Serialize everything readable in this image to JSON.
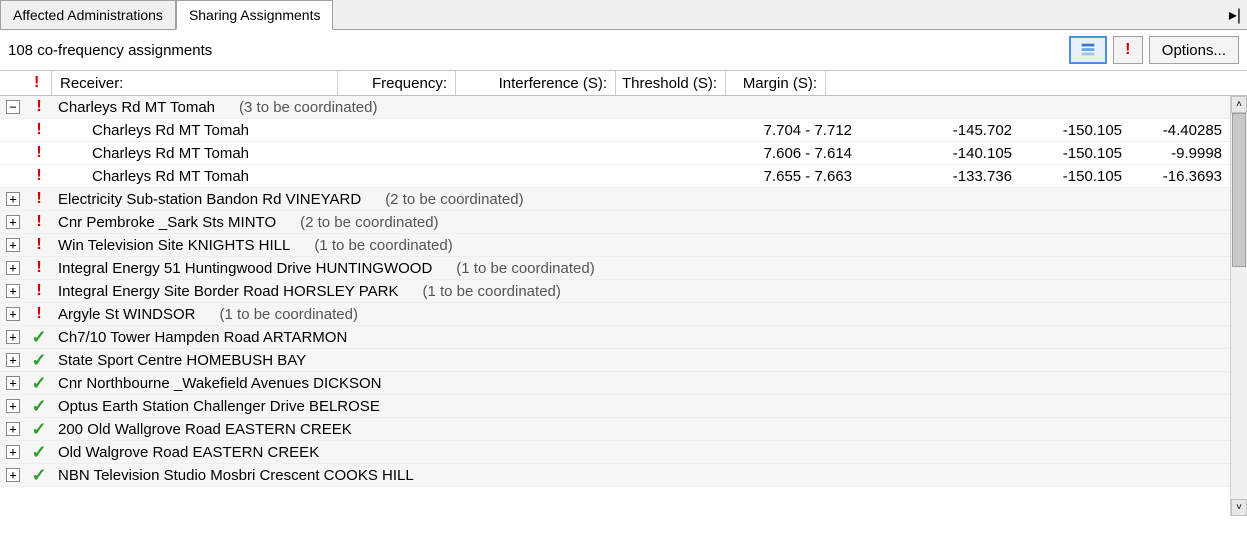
{
  "tabs": [
    {
      "label": "Affected Administrations",
      "active": false
    },
    {
      "label": "Sharing Assignments",
      "active": true
    }
  ],
  "status": "108 co-frequency assignments",
  "options_label": "Options...",
  "columns": {
    "c0": "",
    "c1": "!",
    "receiver": "Receiver:",
    "frequency": "Frequency:",
    "interference": "Interference (S):",
    "threshold": "Threshold (S):",
    "margin": "Margin (S):"
  },
  "groups": [
    {
      "status": "warn",
      "expanded": true,
      "receiver": "Charleys Rd MT Tomah",
      "note": "(3 to be coordinated)",
      "children": [
        {
          "status": "warn",
          "receiver": "Charleys Rd MT Tomah",
          "frequency": "7.704 - 7.712",
          "interference": "-145.702",
          "threshold": "-150.105",
          "margin": "-4.40285"
        },
        {
          "status": "warn",
          "receiver": "Charleys Rd MT Tomah",
          "frequency": "7.606 - 7.614",
          "interference": "-140.105",
          "threshold": "-150.105",
          "margin": "-9.9998"
        },
        {
          "status": "warn",
          "receiver": "Charleys Rd MT Tomah",
          "frequency": "7.655 - 7.663",
          "interference": "-133.736",
          "threshold": "-150.105",
          "margin": "-16.3693"
        }
      ]
    },
    {
      "status": "warn",
      "expanded": false,
      "receiver": "Electricity Sub-station Bandon Rd VINEYARD",
      "note": "(2 to be coordinated)",
      "children": []
    },
    {
      "status": "warn",
      "expanded": false,
      "receiver": "Cnr Pembroke _Sark Sts MINTO",
      "note": "(2 to be coordinated)",
      "children": []
    },
    {
      "status": "warn",
      "expanded": false,
      "receiver": "Win Television Site  KNIGHTS HILL",
      "note": "(1 to be coordinated)",
      "children": []
    },
    {
      "status": "warn",
      "expanded": false,
      "receiver": "Integral Energy 51 Huntingwood Drive  HUNTINGWOOD",
      "note": "(1 to be coordinated)",
      "children": []
    },
    {
      "status": "warn",
      "expanded": false,
      "receiver": "Integral Energy Site  Border Road  HORSLEY PARK",
      "note": "(1 to be coordinated)",
      "children": []
    },
    {
      "status": "warn",
      "expanded": false,
      "receiver": "Argyle St WINDSOR",
      "note": "(1 to be coordinated)",
      "children": []
    },
    {
      "status": "ok",
      "expanded": false,
      "receiver": "Ch7/10 Tower  Hampden Road  ARTARMON",
      "note": "",
      "children": []
    },
    {
      "status": "ok",
      "expanded": false,
      "receiver": "State Sport Centre HOMEBUSH BAY",
      "note": "",
      "children": []
    },
    {
      "status": "ok",
      "expanded": false,
      "receiver": "Cnr Northbourne _Wakefield Avenues DICKSON",
      "note": "",
      "children": []
    },
    {
      "status": "ok",
      "expanded": false,
      "receiver": "Optus Earth Station  Challenger  Drive     BELROSE",
      "note": "",
      "children": []
    },
    {
      "status": "ok",
      "expanded": false,
      "receiver": "200 Old Wallgrove Road EASTERN CREEK",
      "note": "",
      "children": []
    },
    {
      "status": "ok",
      "expanded": false,
      "receiver": "Old Walgrove Road EASTERN CREEK",
      "note": "",
      "children": []
    },
    {
      "status": "ok",
      "expanded": false,
      "receiver": "NBN Television Studio Mosbri Crescent COOKS HILL",
      "note": "",
      "children": []
    }
  ]
}
